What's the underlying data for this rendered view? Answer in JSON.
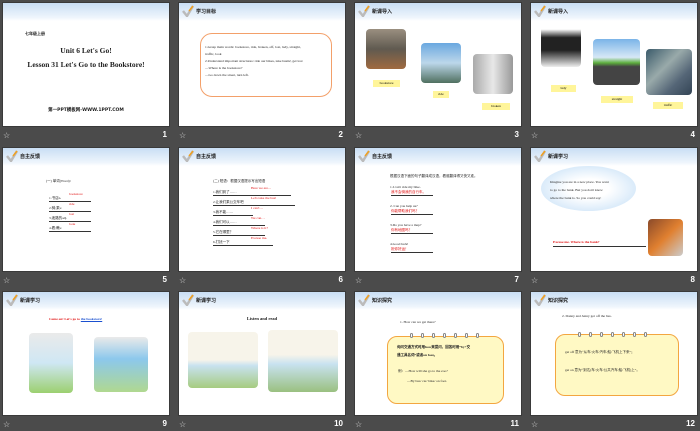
{
  "slides": [
    {
      "number": "1",
      "grade": "七年级上册",
      "title1": "Unit 6 Let's Go!",
      "title2": "Lesson 31 Let's Go to the Bookstore!",
      "footer": "第一PPT模板网-WWW.1PPT.COM"
    },
    {
      "number": "2",
      "section": "学习目标",
      "lines": [
        "1.Grasp main words: bookstore, ride, broken, off, lost, lady, straight,",
        "   traffic, look",
        "2.Understand important structures: ride our bikes, take bus#2, get lost",
        "   —Where is the bookstore?",
        "—Go down the street, turn left."
      ]
    },
    {
      "number": "3",
      "section": "新课导入",
      "labels": [
        "bookstore",
        "ride",
        "broken"
      ]
    },
    {
      "number": "4",
      "section": "新课导入",
      "labels": [
        "lady",
        "straight",
        "traffic"
      ]
    },
    {
      "number": "5",
      "section": "自主反馈",
      "heading": "(一) 单词(Word)：",
      "items": [
        {
          "q": "1.书店n.",
          "a": "bookstore"
        },
        {
          "q": "2.骑;乘v.",
          "a": "ride"
        },
        {
          "q": "3.迷路的adj.",
          "a": "lost"
        },
        {
          "q": "4.看;瞧v.",
          "a": "look"
        }
      ]
    },
    {
      "number": "6",
      "section": "自主反馈",
      "heading": "(二) 短语：根据汉语提示写出短语",
      "items": [
        {
          "q": "1.我们到了……",
          "a": "Here we are…"
        },
        {
          "q": "2.让我们乘公交车吧",
          "a": "Let's take the bus!"
        },
        {
          "q": "3.我不能……",
          "a": "I can't…"
        },
        {
          "q": "4.我们可以……",
          "a": "We can…"
        },
        {
          "q": "5.它在哪里？",
          "a": "Where is it?"
        },
        {
          "q": "6.打扰一下",
          "a": "Excuse me."
        }
      ]
    },
    {
      "number": "7",
      "section": "自主反馈",
      "heading": "根据汉语下面的句子翻译成汉语，看谁翻译得又快又准。",
      "items": [
        {
          "q": "1.I can't ride my bike.",
          "a": "我不会骑我的自行车。"
        },
        {
          "q": "2. Can you help us?",
          "a": "你能帮助我们吗？"
        },
        {
          "q": "3.Do you have a map?",
          "a": "你有地图吗？"
        },
        {
          "q": "4.Good luck!",
          "a": "祝你好运！"
        }
      ]
    },
    {
      "number": "8",
      "section": "新课学习",
      "lines": [
        "Imagine you are in a new place. You want",
        "to go to the bank. But you don't know",
        "where the bank is. So you could say:"
      ],
      "answer": "Excuse me. Where is the bank?"
    },
    {
      "number": "9",
      "section": "新课学习",
      "heading": "Come on! Let's go to ",
      "link": "the bookstore!"
    },
    {
      "number": "10",
      "section": "新课学习",
      "heading": "Listen and read"
    },
    {
      "number": "11",
      "section": "知识探究",
      "heading": "1. How can we get there?",
      "lines": [
        "询问交通方式时用how来提问，回答时用“by+交",
        "通工具名词”或者on foot。",
        "例：—How will she go to the zoo?",
        "—By bus/ car/ bike/ on foot."
      ]
    },
    {
      "number": "12",
      "section": "知识探究",
      "heading": "2. Danny and Jenny get off the bus.",
      "lines": [
        "get off 意为“从车/火车/汽车/船/飞机上下来”；",
        "get on 意为“到达(车/火车/公共汽车/船/飞机)上”。"
      ]
    }
  ],
  "colors": {
    "background": "#4b4b4b",
    "answer": "#e01010",
    "note_border": "#f3a640",
    "note_fill": "#fff9c4"
  }
}
